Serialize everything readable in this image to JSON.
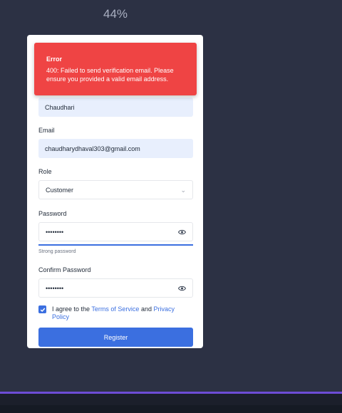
{
  "zoom_level": "44%",
  "toast": {
    "title": "Error",
    "message": "400: Failed to send verification email. Please ensure you provided a valid email address.",
    "color": "#ef4444"
  },
  "form": {
    "last_name_value": "Chaudhari",
    "email_label": "Email",
    "email_value": "chaudharydhaval303@gmail.com",
    "role_label": "Role",
    "role_value": "Customer",
    "password_label": "Password",
    "password_value": "••••••••",
    "password_strength": 1.0,
    "password_strength_text": "Strong password",
    "confirm_label": "Confirm Password",
    "confirm_value": "••••••••",
    "agree_prefix": "I agree to the",
    "terms_link": "Terms of Service",
    "and_text": "and",
    "privacy_link": "Privacy Policy",
    "agree_checked": true,
    "register_label": "Register"
  },
  "colors": {
    "accent": "#3b6fe0",
    "background": "#2c3144"
  }
}
